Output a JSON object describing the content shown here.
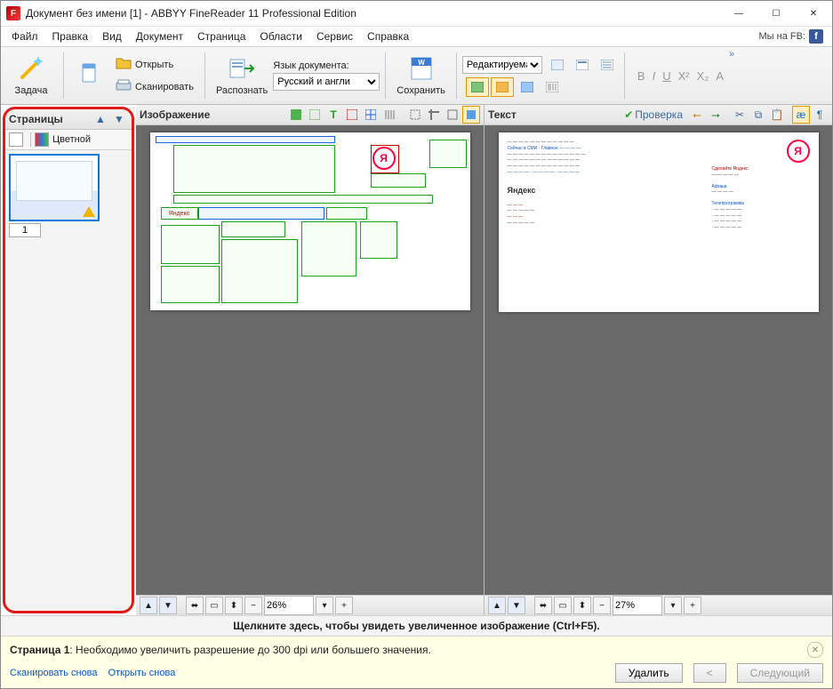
{
  "titlebar": {
    "title": "Документ без имени [1] - ABBYY FineReader 11 Professional Edition"
  },
  "menubar": {
    "items": [
      "Файл",
      "Правка",
      "Вид",
      "Документ",
      "Страница",
      "Области",
      "Сервис",
      "Справка"
    ],
    "fb_text": "Мы на FB:"
  },
  "toolbar": {
    "task_label": "Задача",
    "open_label": "Открыть",
    "scan_label": "Сканировать",
    "recognize_label": "Распознать",
    "lang_caption": "Язык документа:",
    "lang_value": "Русский и англи",
    "save_label": "Сохранить",
    "layout_mode_label": "Редактируемая",
    "format_buttons": {
      "bold": "B",
      "italic": "I",
      "underline": "U",
      "super": "X²",
      "sub": "X₂",
      "style": "A"
    }
  },
  "panels": {
    "pages": {
      "title": "Страницы",
      "view_mode": "Цветной",
      "current_page": "1"
    },
    "image": {
      "title": "Изображение",
      "zoom": "26%"
    },
    "text": {
      "title": "Текст",
      "verify_label": "Проверка",
      "zoom": "27%"
    }
  },
  "hint": {
    "text": "Щелкните здесь, чтобы увидеть увеличенное изображение (Ctrl+F5)."
  },
  "warning": {
    "page_prefix": "Страница 1",
    "msg": ": Необходимо увеличить разрешение до 300 dpi или большего значения.",
    "scan_again": "Сканировать снова",
    "open_again": "Открыть снова",
    "delete_btn": "Удалить",
    "prev_btn": "<",
    "next_btn": "Следующий"
  },
  "doc_preview": {
    "brand": "Яндекс"
  }
}
